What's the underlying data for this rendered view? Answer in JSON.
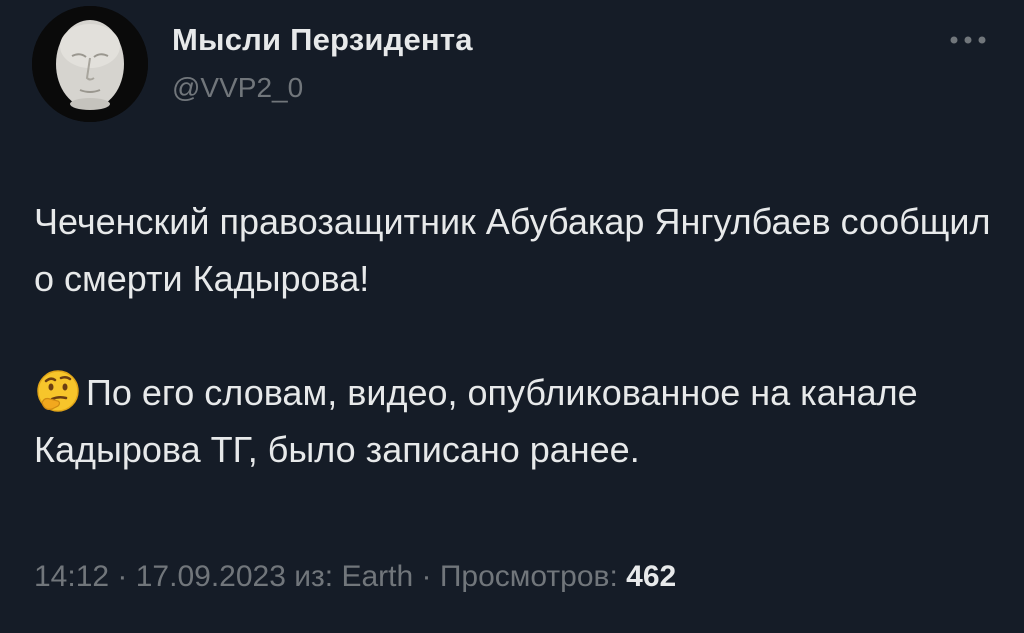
{
  "author": {
    "display_name": "Мысли Перзидента",
    "handle": "@VVP2_0",
    "avatar_icon": "death-mask-avatar"
  },
  "tweet": {
    "paragraph_1": "Чеченский правозащитник Абубакар Янгулбаев сообщил о смерти Кадырова!",
    "emoji_icon": "thinking-face-emoji",
    "paragraph_2": "По его словам, видео, опубликованное на канале Кадырова ТГ, было записано ранее."
  },
  "meta": {
    "time": "14:12",
    "separator_1": " · ",
    "date": "17.09.2023",
    "source_prefix": " из: ",
    "source": "Earth",
    "separator_2": " · ",
    "views_label": "Просмотров: ",
    "views_count": "462"
  },
  "colors": {
    "background": "#151c27",
    "primary_text": "#e7e9ea",
    "secondary_text": "#71767b"
  },
  "more_icon": "more-horizontal-icon"
}
